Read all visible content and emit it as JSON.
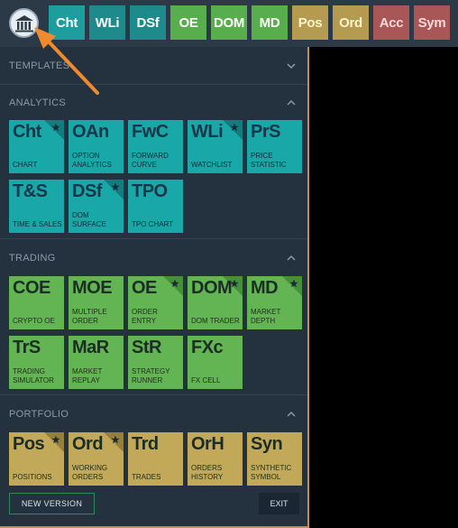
{
  "topbar": {
    "logo_icon": "pillars-logo-icon",
    "buttons": [
      {
        "label": "Cht",
        "color": "#1e9d9f"
      },
      {
        "label": "WLi",
        "color": "#1f8a8c"
      },
      {
        "label": "DSf",
        "color": "#1f8a8c"
      },
      {
        "label": "OE",
        "color": "#58ad4d"
      },
      {
        "label": "DOM",
        "color": "#58ad4d"
      },
      {
        "label": "MD",
        "color": "#58ad4d"
      },
      {
        "label": "Pos",
        "color": "#b49b4f"
      },
      {
        "label": "Ord",
        "color": "#b49b4f"
      },
      {
        "label": "Acc",
        "color": "#a85656"
      },
      {
        "label": "Sym",
        "color": "#a85656"
      }
    ]
  },
  "sections": {
    "templates": "TEMPLATES",
    "analytics": "ANALYTICS",
    "trading": "TRADING",
    "portfolio": "PORTFOLIO"
  },
  "analytics_tiles": [
    {
      "abbr": "Cht",
      "label": "CHART",
      "starred": true
    },
    {
      "abbr": "OAn",
      "label": "OPTION ANALYTICS",
      "starred": false
    },
    {
      "abbr": "FwC",
      "label": "FORWARD CURVE",
      "starred": false
    },
    {
      "abbr": "WLi",
      "label": "WATCHLIST",
      "starred": true
    },
    {
      "abbr": "PrS",
      "label": "PRICE STATISTIC",
      "starred": false
    },
    {
      "abbr": "T&S",
      "label": "TIME & SALES",
      "starred": false
    },
    {
      "abbr": "DSf",
      "label": "DOM SURFACE",
      "starred": true
    },
    {
      "abbr": "TPO",
      "label": "TPO CHART",
      "starred": false
    }
  ],
  "trading_tiles": [
    {
      "abbr": "COE",
      "label": "CRYPTO OE",
      "starred": false
    },
    {
      "abbr": "MOE",
      "label": "MULTIPLE ORDER",
      "starred": false
    },
    {
      "abbr": "OE",
      "label": "ORDER ENTRY",
      "starred": true
    },
    {
      "abbr": "DOM",
      "label": "DOM TRADER",
      "starred": true
    },
    {
      "abbr": "MD",
      "label": "MARKET DEPTH",
      "starred": true
    },
    {
      "abbr": "TrS",
      "label": "TRADING SIMULATOR",
      "starred": false
    },
    {
      "abbr": "MaR",
      "label": "MARKET REPLAY",
      "starred": false
    },
    {
      "abbr": "StR",
      "label": "STRATEGY RUNNER",
      "starred": false
    },
    {
      "abbr": "FXc",
      "label": "FX CELL",
      "starred": false
    }
  ],
  "portfolio_tiles": [
    {
      "abbr": "Pos",
      "label": "POSITIONS",
      "starred": true
    },
    {
      "abbr": "Ord",
      "label": "WORKING ORDERS",
      "starred": true
    },
    {
      "abbr": "Trd",
      "label": "TRADES",
      "starred": false
    },
    {
      "abbr": "OrH",
      "label": "ORDERS HISTORY",
      "starred": false
    },
    {
      "abbr": "Syn",
      "label": "SYNTHETIC SYMBOL",
      "starred": false
    }
  ],
  "footer": {
    "new_version": "NEW VERSION",
    "exit": "EXIT"
  },
  "annotation": {
    "arrow_color": "#f08a2e"
  }
}
